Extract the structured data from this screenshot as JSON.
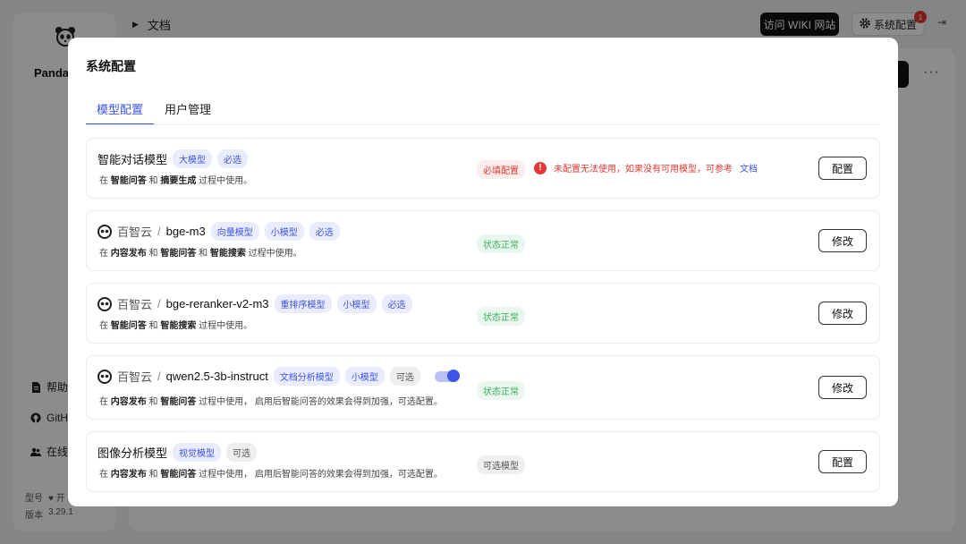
{
  "app": {
    "logo_text": "Panda",
    "breadcrumb": "文档",
    "wiki_button": "访问 WIKI 网站",
    "settings_button": "系统配置",
    "notification_count": "1",
    "sidebar_links": [
      {
        "label": "帮助",
        "icon": "document-icon"
      },
      {
        "label": "GitH",
        "icon": "github-icon"
      },
      {
        "label": "在线",
        "icon": "people-icon"
      }
    ],
    "meta": [
      {
        "label": "型号",
        "value": "♥ 开"
      },
      {
        "label": "版本",
        "value": "3.29.1"
      }
    ]
  },
  "modal": {
    "title": "系统配置",
    "tabs": [
      {
        "label": "模型配置",
        "active": true
      },
      {
        "label": "用户管理",
        "active": false
      }
    ],
    "cards": [
      {
        "name": "智能对话模型",
        "tags": [
          "大模型",
          "必选"
        ],
        "desc_parts": [
          "在 ",
          "智能问答",
          " 和 ",
          "摘要生成",
          " 过程中使用。"
        ],
        "status": "必填配置",
        "warning": "未配置无法使用，如果没有可用模型，可参考",
        "warning_link": "文档",
        "button": "配置"
      },
      {
        "provider": "百智云",
        "model": "bge-m3",
        "tags": [
          "向量模型",
          "小模型",
          "必选"
        ],
        "desc_parts": [
          "在 ",
          "内容发布",
          " 和 ",
          "智能问答",
          " 和 ",
          "智能搜索",
          " 过程中使用。"
        ],
        "status": "状态正常",
        "button": "修改"
      },
      {
        "provider": "百智云",
        "model": "bge-reranker-v2-m3",
        "tags": [
          "重排序模型",
          "小模型",
          "必选"
        ],
        "desc_parts": [
          "在 ",
          "智能问答",
          " 和 ",
          "智能搜索",
          " 过程中使用。"
        ],
        "status": "状态正常",
        "button": "修改"
      },
      {
        "provider": "百智云",
        "model": "qwen2.5-3b-instruct",
        "tags": [
          "文档分析模型",
          "小模型",
          "可选"
        ],
        "toggle_on": true,
        "desc_parts": [
          "在 ",
          "内容发布",
          " 和 ",
          "智能问答",
          " 过程中使用， 启用后智能问答的效果会得到加强，可选配置。"
        ],
        "status": "状态正常",
        "button": "修改"
      },
      {
        "name": "图像分析模型",
        "tags": [
          "视觉模型",
          "可选"
        ],
        "desc_parts": [
          "在 ",
          "内容发布",
          " 和 ",
          "智能问答",
          " 过程中使用， 启用后智能问答的效果会得到加强，可选配置。"
        ],
        "status": "可选模型",
        "button": "配置"
      }
    ]
  }
}
